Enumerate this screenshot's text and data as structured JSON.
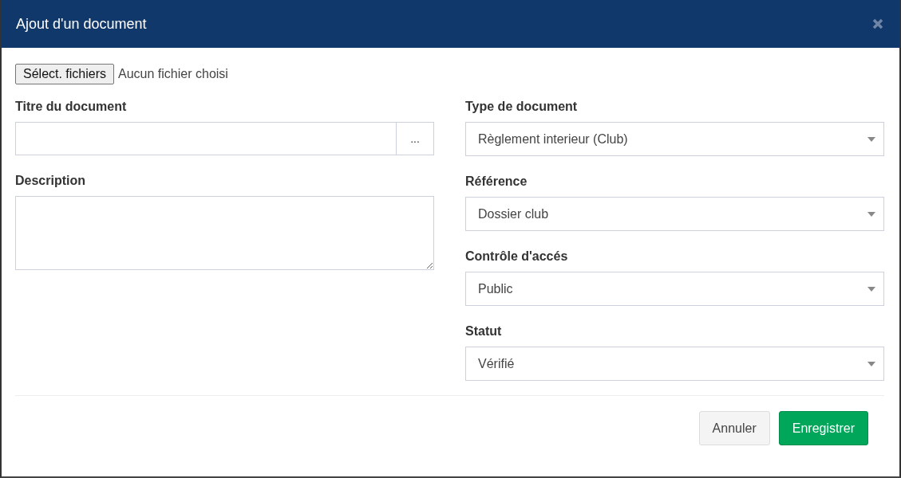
{
  "dialog": {
    "title": "Ajout d'un document"
  },
  "file_picker": {
    "button": "Sélect. fichiers",
    "status": "Aucun fichier choisi"
  },
  "left_fields": [
    {
      "label": "Titre du document",
      "kind": "text_with_button",
      "button": "..."
    },
    {
      "label": "Description",
      "kind": "textarea"
    }
  ],
  "right_fields": [
    {
      "label": "Type de document",
      "kind": "select",
      "value": "Règlement interieur (Club)"
    },
    {
      "label": "Référence",
      "kind": "select",
      "value": "Dossier club"
    },
    {
      "label": "Contrôle d'accés",
      "kind": "select",
      "value": "Public"
    },
    {
      "label": "Statut",
      "kind": "select",
      "value": "Vérifié"
    }
  ],
  "buttons": [
    {
      "label": "Annuler",
      "kind": "default"
    },
    {
      "label": "Enregistrer",
      "kind": "primary"
    }
  ]
}
